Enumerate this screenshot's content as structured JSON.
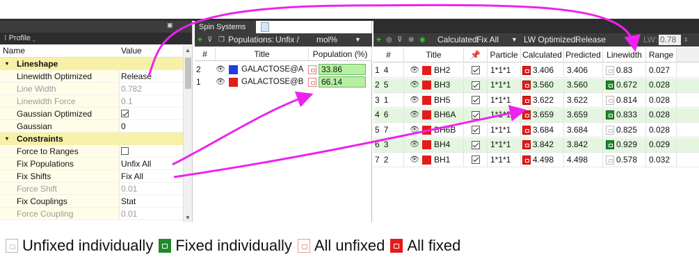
{
  "profile_tab": "Profile",
  "left_columns": {
    "name": "Name",
    "value": "Value"
  },
  "lineshape": {
    "header": "Lineshape",
    "rows": [
      {
        "name": "Linewidth Optimized",
        "value": "Release"
      },
      {
        "name": "Line Width",
        "value": "0.782"
      },
      {
        "name": "Linewidth Force",
        "value": "0.1"
      },
      {
        "name": "Gaussian Optimized",
        "value": "checked"
      },
      {
        "name": "Gaussian",
        "value": "0"
      }
    ]
  },
  "constraints": {
    "header": "Constraints",
    "rows": [
      {
        "name": "Force to Ranges",
        "value": "unchecked"
      },
      {
        "name": "Fix Populations",
        "value": "Unfix All"
      },
      {
        "name": "Fix Shifts",
        "value": "Fix All"
      },
      {
        "name": "Force Shift",
        "value": "0.01"
      },
      {
        "name": "Fix Couplings",
        "value": "Stat"
      },
      {
        "name": "Force Coupling",
        "value": "0.01"
      }
    ]
  },
  "spin_panel": {
    "tab": "Spin Systems",
    "populations_label": "Populations:",
    "populations_value": "Unfix /",
    "units_value": "mol%",
    "columns": {
      "num": "#",
      "title": "Title",
      "population": "Population (%)"
    },
    "rows": [
      {
        "num": "2",
        "title": "GALACTOSE@A",
        "color": "#1f3de0",
        "population": "33.86"
      },
      {
        "num": "1",
        "title": "GALACTOSE@B",
        "color": "#e41b1b",
        "population": "66.14"
      }
    ]
  },
  "right_panel": {
    "calculated_label": "Calculated:",
    "calculated_value": "Fix All",
    "lw_optimized_label": "LW Optimized:",
    "lw_optimized_value": "Release",
    "lw_label": "LW:",
    "lw_value": "0.78",
    "columns": {
      "num": "#",
      "title": "Title",
      "pin": "",
      "particle": "Particle",
      "calculated": "Calculated",
      "predicted": "Predicted",
      "linewidth": "Linewidth",
      "range": "Range"
    },
    "rows": [
      {
        "idx": "1",
        "num": "4",
        "title": "BH2",
        "particle": "1*1*1",
        "calculated": "3.406",
        "predicted": "3.406",
        "linewidth": "0.83",
        "lw_fixed": false,
        "range": "0.027"
      },
      {
        "idx": "2",
        "num": "5",
        "title": "BH3",
        "particle": "1*1*1",
        "calculated": "3.560",
        "predicted": "3.560",
        "linewidth": "0.672",
        "lw_fixed": true,
        "range": "0.028"
      },
      {
        "idx": "3",
        "num": "1",
        "title": "BH5",
        "particle": "1*1*1",
        "calculated": "3.622",
        "predicted": "3.622",
        "linewidth": "0.814",
        "lw_fixed": false,
        "range": "0.028"
      },
      {
        "idx": "4",
        "num": "6",
        "title": "BH6A",
        "particle": "1*1*1",
        "calculated": "3.659",
        "predicted": "3.659",
        "linewidth": "0.833",
        "lw_fixed": true,
        "range": "0.028"
      },
      {
        "idx": "5",
        "num": "7",
        "title": "BH6B",
        "particle": "1*1*1",
        "calculated": "3.684",
        "predicted": "3.684",
        "linewidth": "0.825",
        "lw_fixed": false,
        "range": "0.028"
      },
      {
        "idx": "6",
        "num": "3",
        "title": "BH4",
        "particle": "1*1*1",
        "calculated": "3.842",
        "predicted": "3.842",
        "linewidth": "0.929",
        "lw_fixed": true,
        "range": "0.029"
      },
      {
        "idx": "7",
        "num": "2",
        "title": "BH1",
        "particle": "1*1*1",
        "calculated": "4.498",
        "predicted": "4.498",
        "linewidth": "0.578",
        "lw_fixed": false,
        "range": "0.032"
      }
    ]
  },
  "legend": [
    {
      "icon": "unfixed-individually-lock-icon",
      "label": "Unfixed individually"
    },
    {
      "icon": "fixed-individually-lock-icon",
      "label": "Fixed individually"
    },
    {
      "icon": "all-unfixed-lock-icon",
      "label": "All unfixed"
    },
    {
      "icon": "all-fixed-lock-icon",
      "label": "All fixed"
    }
  ],
  "colors": {
    "arrow": "#ee22ee",
    "alt_row": "#e4f6e0",
    "category": "#f7f1a8",
    "fixed_green": "#1f8a2b",
    "fixed_red": "#e41b1b"
  }
}
